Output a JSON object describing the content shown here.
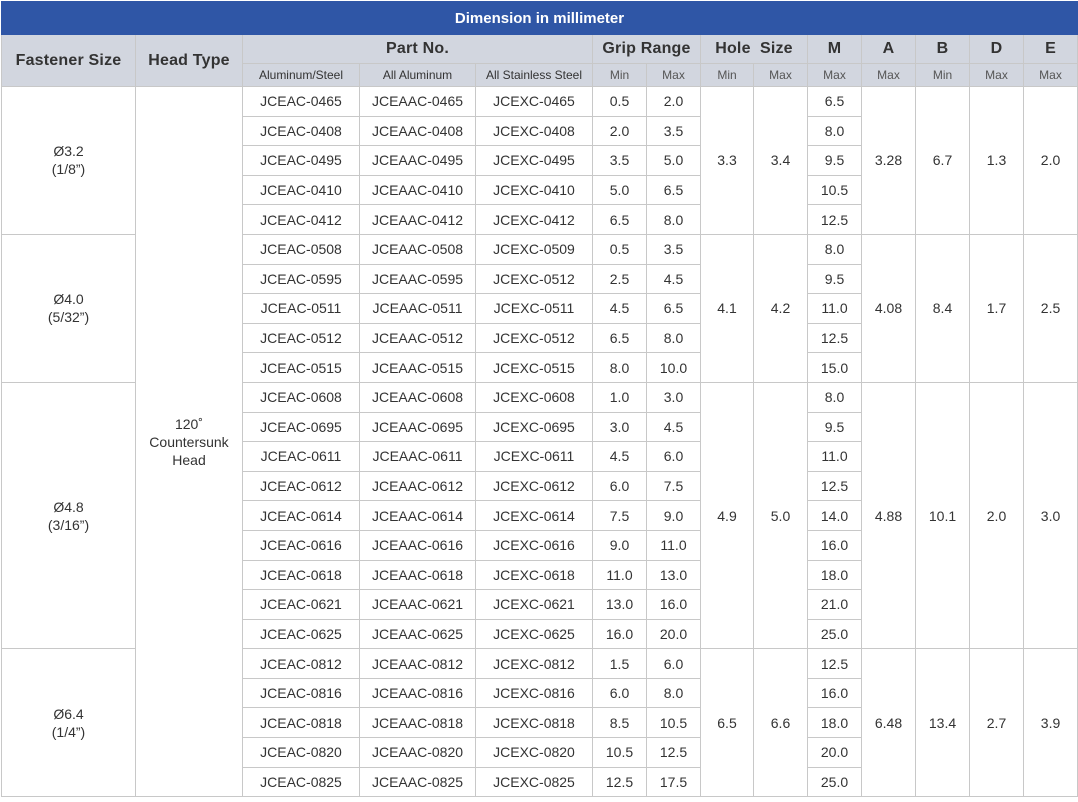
{
  "title": "Dimension in millimeter",
  "headers": {
    "fastener_size": "Fastener Size",
    "head_type": "Head Type",
    "part_no": "Part No.",
    "grip_range": "Grip Range",
    "hole_size": "Hole  Size",
    "m": "M",
    "a": "A",
    "b": "B",
    "d": "D",
    "e": "E"
  },
  "subheaders": {
    "aluminum_steel": "Aluminum/Steel",
    "all_aluminum": "All Aluminum",
    "all_stainless": "All Stainless Steel",
    "grip_min": "Min",
    "grip_max": "Max",
    "hole_min": "Min",
    "hole_max": "Max",
    "m": "Max",
    "a": "Max",
    "b": "Min",
    "d": "Max",
    "e": "Max"
  },
  "head_type": [
    "120˚",
    "Countersunk",
    "Head"
  ],
  "groups": [
    {
      "size": [
        "Ø3.2",
        "(1/8”)"
      ],
      "hole_min": "3.3",
      "hole_max": "3.4",
      "a": "3.28",
      "b": "6.7",
      "d": "1.3",
      "e": "2.0",
      "rows": [
        {
          "p1": "JCEAC-0465",
          "p2": "JCEAAC-0465",
          "p3": "JCEXC-0465",
          "gmin": "0.5",
          "gmax": "2.0",
          "m": "6.5"
        },
        {
          "p1": "JCEAC-0408",
          "p2": "JCEAAC-0408",
          "p3": "JCEXC-0408",
          "gmin": "2.0",
          "gmax": "3.5",
          "m": "8.0"
        },
        {
          "p1": "JCEAC-0495",
          "p2": "JCEAAC-0495",
          "p3": "JCEXC-0495",
          "gmin": "3.5",
          "gmax": "5.0",
          "m": "9.5"
        },
        {
          "p1": "JCEAC-0410",
          "p2": "JCEAAC-0410",
          "p3": "JCEXC-0410",
          "gmin": "5.0",
          "gmax": "6.5",
          "m": "10.5"
        },
        {
          "p1": "JCEAC-0412",
          "p2": "JCEAAC-0412",
          "p3": "JCEXC-0412",
          "gmin": "6.5",
          "gmax": "8.0",
          "m": "12.5"
        }
      ]
    },
    {
      "size": [
        "Ø4.0",
        "(5/32”)"
      ],
      "hole_min": "4.1",
      "hole_max": "4.2",
      "a": "4.08",
      "b": "8.4",
      "d": "1.7",
      "e": "2.5",
      "rows": [
        {
          "p1": "JCEAC-0508",
          "p2": "JCEAAC-0508",
          "p3": "JCEXC-0509",
          "gmin": "0.5",
          "gmax": "3.5",
          "m": "8.0"
        },
        {
          "p1": "JCEAC-0595",
          "p2": "JCEAAC-0595",
          "p3": "JCEXC-0512",
          "gmin": "2.5",
          "gmax": "4.5",
          "m": "9.5"
        },
        {
          "p1": "JCEAC-0511",
          "p2": "JCEAAC-0511",
          "p3": "JCEXC-0511",
          "gmin": "4.5",
          "gmax": "6.5",
          "m": "11.0"
        },
        {
          "p1": "JCEAC-0512",
          "p2": "JCEAAC-0512",
          "p3": "JCEXC-0512",
          "gmin": "6.5",
          "gmax": "8.0",
          "m": "12.5"
        },
        {
          "p1": "JCEAC-0515",
          "p2": "JCEAAC-0515",
          "p3": "JCEXC-0515",
          "gmin": "8.0",
          "gmax": "10.0",
          "m": "15.0"
        }
      ]
    },
    {
      "size": [
        "Ø4.8",
        "(3/16”)"
      ],
      "hole_min": "4.9",
      "hole_max": "5.0",
      "a": "4.88",
      "b": "10.1",
      "d": "2.0",
      "e": "3.0",
      "rows": [
        {
          "p1": "JCEAC-0608",
          "p2": "JCEAAC-0608",
          "p3": "JCEXC-0608",
          "gmin": "1.0",
          "gmax": "3.0",
          "m": "8.0"
        },
        {
          "p1": "JCEAC-0695",
          "p2": "JCEAAC-0695",
          "p3": "JCEXC-0695",
          "gmin": "3.0",
          "gmax": "4.5",
          "m": "9.5"
        },
        {
          "p1": "JCEAC-0611",
          "p2": "JCEAAC-0611",
          "p3": "JCEXC-0611",
          "gmin": "4.5",
          "gmax": "6.0",
          "m": "11.0"
        },
        {
          "p1": "JCEAC-0612",
          "p2": "JCEAAC-0612",
          "p3": "JCEXC-0612",
          "gmin": "6.0",
          "gmax": "7.5",
          "m": "12.5"
        },
        {
          "p1": "JCEAC-0614",
          "p2": "JCEAAC-0614",
          "p3": "JCEXC-0614",
          "gmin": "7.5",
          "gmax": "9.0",
          "m": "14.0"
        },
        {
          "p1": "JCEAC-0616",
          "p2": "JCEAAC-0616",
          "p3": "JCEXC-0616",
          "gmin": "9.0",
          "gmax": "11.0",
          "m": "16.0"
        },
        {
          "p1": "JCEAC-0618",
          "p2": "JCEAAC-0618",
          "p3": "JCEXC-0618",
          "gmin": "11.0",
          "gmax": "13.0",
          "m": "18.0"
        },
        {
          "p1": "JCEAC-0621",
          "p2": "JCEAAC-0621",
          "p3": "JCEXC-0621",
          "gmin": "13.0",
          "gmax": "16.0",
          "m": "21.0"
        },
        {
          "p1": "JCEAC-0625",
          "p2": "JCEAAC-0625",
          "p3": "JCEXC-0625",
          "gmin": "16.0",
          "gmax": "20.0",
          "m": "25.0"
        }
      ]
    },
    {
      "size": [
        "Ø6.4",
        "(1/4”)"
      ],
      "hole_min": "6.5",
      "hole_max": "6.6",
      "a": "6.48",
      "b": "13.4",
      "d": "2.7",
      "e": "3.9",
      "rows": [
        {
          "p1": "JCEAC-0812",
          "p2": "JCEAAC-0812",
          "p3": "JCEXC-0812",
          "gmin": "1.5",
          "gmax": "6.0",
          "m": "12.5"
        },
        {
          "p1": "JCEAC-0816",
          "p2": "JCEAAC-0816",
          "p3": "JCEXC-0816",
          "gmin": "6.0",
          "gmax": "8.0",
          "m": "16.0"
        },
        {
          "p1": "JCEAC-0818",
          "p2": "JCEAAC-0818",
          "p3": "JCEXC-0818",
          "gmin": "8.5",
          "gmax": "10.5",
          "m": "18.0"
        },
        {
          "p1": "JCEAC-0820",
          "p2": "JCEAAC-0820",
          "p3": "JCEXC-0820",
          "gmin": "10.5",
          "gmax": "12.5",
          "m": "20.0"
        },
        {
          "p1": "JCEAC-0825",
          "p2": "JCEAAC-0825",
          "p3": "JCEXC-0825",
          "gmin": "12.5",
          "gmax": "17.5",
          "m": "25.0"
        }
      ]
    }
  ]
}
